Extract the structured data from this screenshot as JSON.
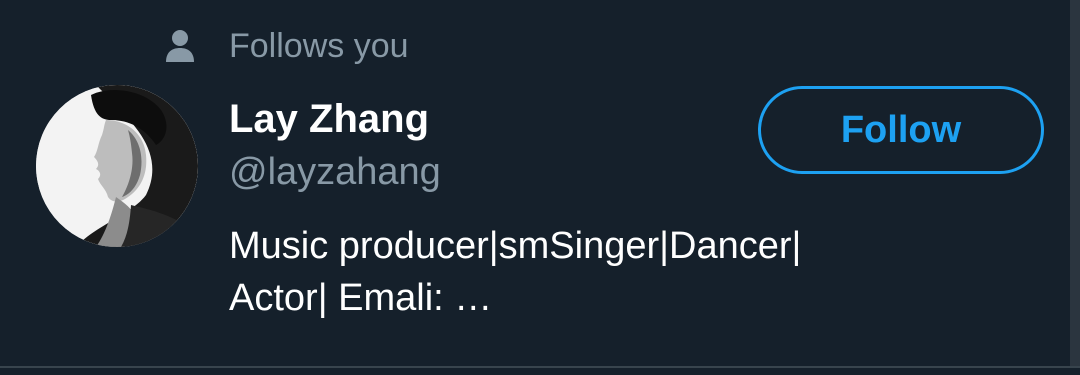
{
  "context": {
    "icon": "person-icon",
    "text": "Follows you"
  },
  "user": {
    "display_name": "Lay Zhang",
    "handle": "@layzahang",
    "bio_lines": [
      "Music producer|smSinger|Dancer|",
      "Actor| Emali: …"
    ],
    "avatar": "profile-avatar"
  },
  "follow_button": {
    "label": "Follow"
  },
  "colors": {
    "background": "#15202b",
    "accent": "#1da1f2",
    "secondary_text": "#8899a6",
    "primary_text": "#ffffff"
  }
}
